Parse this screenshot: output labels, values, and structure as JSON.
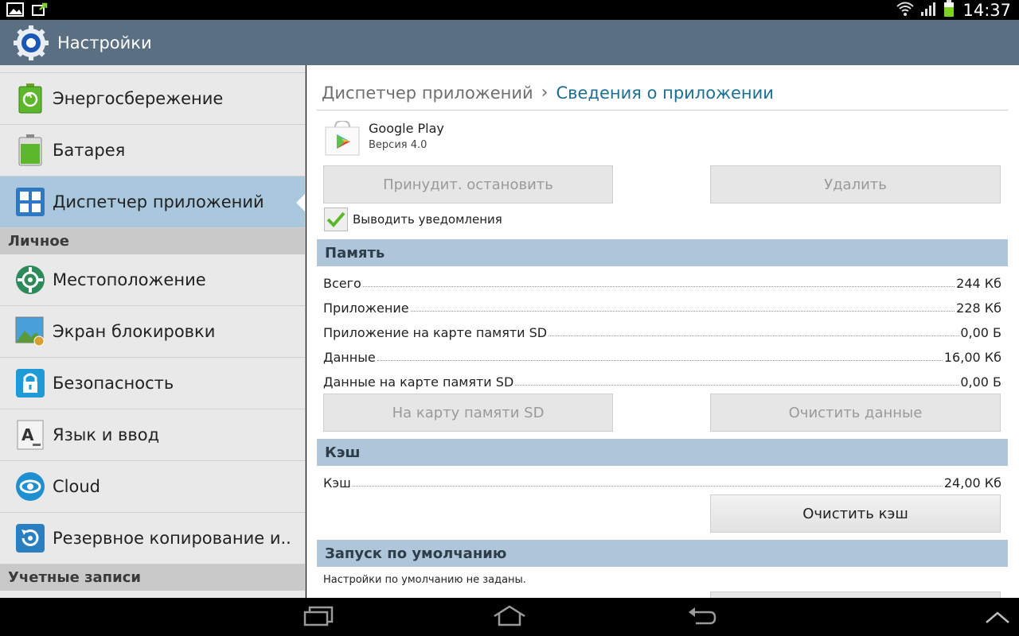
{
  "status_bar": {
    "time": "14:37",
    "icons": [
      "picture-notification-icon",
      "sync-notification-icon",
      "wifi-icon",
      "signal-icon",
      "battery-icon"
    ]
  },
  "action_bar": {
    "title": "Настройки",
    "icon": "settings-gear-icon"
  },
  "sidebar": {
    "items": [
      {
        "label": "Энергосбережение",
        "icon": "power-saving-icon"
      },
      {
        "label": "Батарея",
        "icon": "battery-icon"
      },
      {
        "label": "Диспетчер приложений",
        "icon": "app-manager-icon",
        "selected": true
      }
    ],
    "section_personal": "Личное",
    "personal_items": [
      {
        "label": "Местоположение",
        "icon": "location-icon"
      },
      {
        "label": "Экран блокировки",
        "icon": "lock-screen-icon"
      },
      {
        "label": "Безопасность",
        "icon": "security-lock-icon"
      },
      {
        "label": "Язык и ввод",
        "icon": "language-icon"
      },
      {
        "label": "Cloud",
        "icon": "cloud-icon"
      },
      {
        "label": "Резервное копирование и..",
        "icon": "backup-icon"
      }
    ],
    "section_accounts": "Учетные записи"
  },
  "breadcrumb": {
    "parent": "Диспетчер приложений",
    "separator": "›",
    "current": "Сведения о приложении"
  },
  "app": {
    "name": "Google Play",
    "version": "Версия 4.0"
  },
  "buttons": {
    "force_stop": "Принудит. остановить",
    "uninstall": "Удалить",
    "move_to_sd": "На карту памяти SD",
    "clear_data": "Очистить данные",
    "clear_cache": "Очистить кэш"
  },
  "notifications_checkbox": {
    "label": "Выводить уведомления",
    "checked": true
  },
  "memory": {
    "header": "Память",
    "rows": [
      {
        "label": "Всего",
        "value": "244 Кб"
      },
      {
        "label": "Приложение",
        "value": "228 Кб"
      },
      {
        "label": "Приложение на карте памяти SD",
        "value": "0,00 Б"
      },
      {
        "label": "Данные",
        "value": "16,00 Кб"
      },
      {
        "label": "Данные на карте памяти SD",
        "value": "0,00 Б"
      }
    ]
  },
  "cache": {
    "header": "Кэш",
    "label": "Кэш",
    "value": "24,00 Кб"
  },
  "launch_default": {
    "header": "Запуск по умолчанию",
    "note": "Настройки по умолчанию не заданы."
  },
  "colors": {
    "action_bar": "#5b6f82",
    "section_header": "#afc6da",
    "selected_item": "#a9c7dd",
    "breadcrumb_current": "#1d6f93"
  }
}
